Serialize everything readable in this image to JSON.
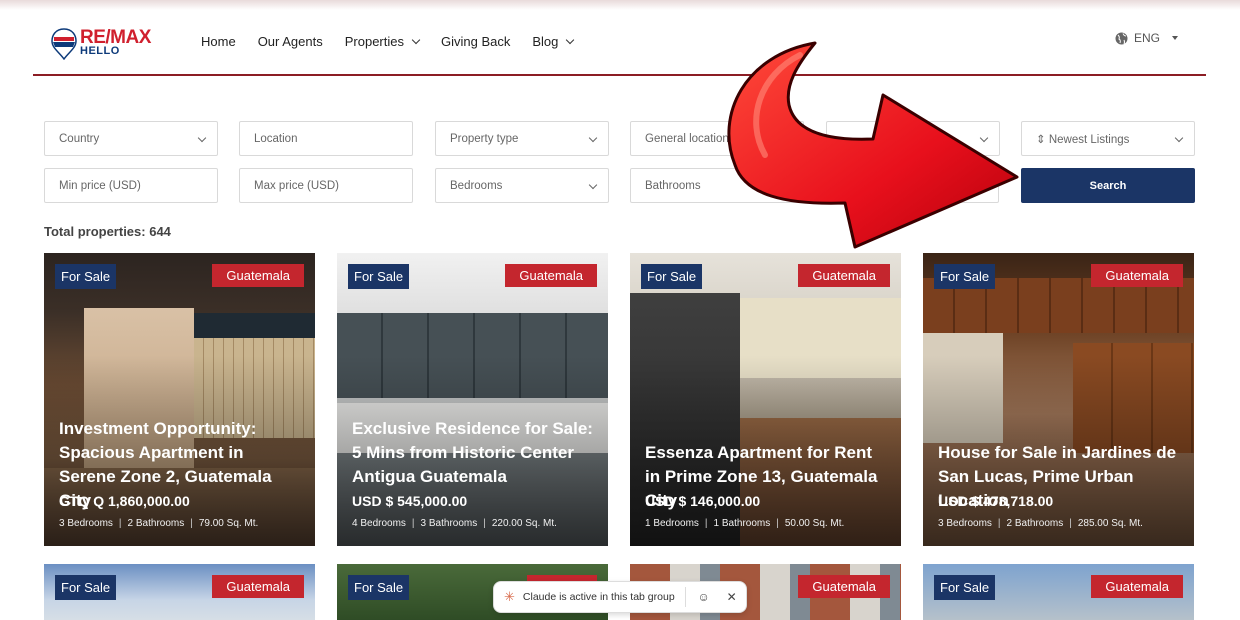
{
  "logo": {
    "brand": "RE/MAX",
    "sub": "HELLO"
  },
  "nav": [
    {
      "label": "Home",
      "dropdown": false
    },
    {
      "label": "Our Agents",
      "dropdown": false
    },
    {
      "label": "Properties",
      "dropdown": true
    },
    {
      "label": "Giving Back",
      "dropdown": false
    },
    {
      "label": "Blog",
      "dropdown": true
    }
  ],
  "language": "ENG",
  "filters": {
    "country": "Country",
    "location_placeholder": "Location",
    "property_type": "Property type",
    "general_location": "General location",
    "sort": "⇕ Newest Listings",
    "min_price_placeholder": "Min price (USD)",
    "max_price_placeholder": "Max price (USD)",
    "bedrooms": "Bedrooms",
    "bathrooms": "Bathrooms",
    "search": "Search"
  },
  "total": "Total properties: 644",
  "cards": [
    {
      "status": "For Sale",
      "location": "Guatemala",
      "title": "Investment Opportunity: Spacious Apartment in Serene Zone 2, Guatemala City",
      "price": "GTQ Q 1,860,000.00",
      "bedrooms": "3 Bedrooms",
      "bathrooms": "2 Bathrooms",
      "area": "79.00 Sq. Mt."
    },
    {
      "status": "For Sale",
      "location": "Guatemala",
      "title": "Exclusive Residence for Sale: 5 Mins from Historic Center Antigua Guatemala",
      "price": "USD $ 545,000.00",
      "bedrooms": "4 Bedrooms",
      "bathrooms": "3 Bathrooms",
      "area": "220.00 Sq. Mt."
    },
    {
      "status": "For Sale",
      "location": "Guatemala",
      "title": "Essenza Apartment for Rent in Prime Zone 13, Guatemala City",
      "price": "USD $ 146,000.00",
      "bedrooms": "1 Bedrooms",
      "bathrooms": "1 Bathrooms",
      "area": "50.00 Sq. Mt."
    },
    {
      "status": "For Sale",
      "location": "Guatemala",
      "title": "House for Sale in Jardines de San Lucas, Prime Urban Location",
      "price": "USD $ 478,718.00",
      "bedrooms": "3 Bedrooms",
      "bathrooms": "2 Bathrooms",
      "area": "285.00 Sq. Mt."
    }
  ],
  "cards_row2": [
    {
      "status": "For Sale",
      "location": "Guatemala"
    },
    {
      "status": "For Sale",
      "location": ""
    },
    {
      "status": "",
      "location": "Guatemala"
    },
    {
      "status": "For Sale",
      "location": "Guatemala"
    }
  ],
  "banner": {
    "text": "Claude is active in this tab group"
  },
  "colors": {
    "brand_blue": "#1b3566",
    "brand_red": "#c4262e",
    "divider": "#8c1d24"
  }
}
